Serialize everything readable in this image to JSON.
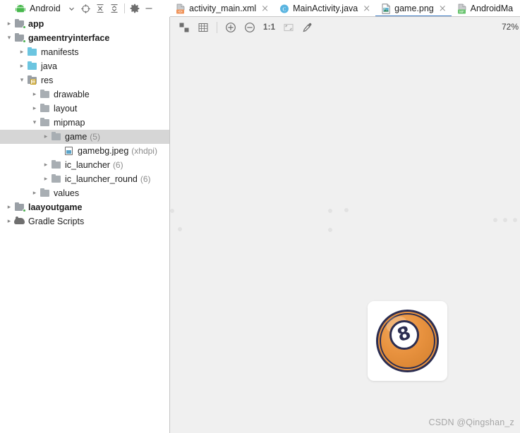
{
  "project_panel": {
    "title": "Android",
    "icons": [
      {
        "name": "android-logo-icon",
        "glyph": "android"
      },
      {
        "name": "chevron-down-icon",
        "glyph": "▾"
      },
      {
        "name": "locate-selection-icon",
        "glyph": "⊕"
      },
      {
        "name": "expand-all-icon",
        "glyph": "⨌"
      },
      {
        "name": "collapse-all-icon",
        "glyph": "⨋"
      },
      {
        "name": "gear-settings-icon",
        "glyph": "⚙"
      },
      {
        "name": "hide-panel-icon",
        "glyph": "—"
      }
    ],
    "tree": [
      {
        "label": "app",
        "suffix": "",
        "depth": 0,
        "arrow": "collapsed",
        "bold": true,
        "icon": "module-folder-icon",
        "selected": false
      },
      {
        "label": "gameentryinterface",
        "suffix": "",
        "depth": 0,
        "arrow": "expanded",
        "bold": true,
        "icon": "module-folder-icon",
        "selected": false
      },
      {
        "label": "manifests",
        "suffix": "",
        "depth": 1,
        "arrow": "collapsed",
        "bold": false,
        "icon": "blue-folder-icon",
        "selected": false
      },
      {
        "label": "java",
        "suffix": "",
        "depth": 1,
        "arrow": "collapsed",
        "bold": false,
        "icon": "blue-folder-icon",
        "selected": false
      },
      {
        "label": "res",
        "suffix": "",
        "depth": 1,
        "arrow": "expanded",
        "bold": false,
        "icon": "res-folder-icon",
        "selected": false
      },
      {
        "label": "drawable",
        "suffix": "",
        "depth": 2,
        "arrow": "collapsed",
        "bold": false,
        "icon": "gray-folder-icon",
        "selected": false
      },
      {
        "label": "layout",
        "suffix": "",
        "depth": 2,
        "arrow": "collapsed",
        "bold": false,
        "icon": "gray-folder-icon",
        "selected": false
      },
      {
        "label": "mipmap",
        "suffix": "",
        "depth": 2,
        "arrow": "expanded",
        "bold": false,
        "icon": "gray-folder-icon",
        "selected": false
      },
      {
        "label": "game",
        "suffix": "(5)",
        "depth": 3,
        "arrow": "collapsed",
        "bold": false,
        "icon": "gray-folder-icon",
        "selected": true
      },
      {
        "label": "gamebg.jpeg",
        "suffix": "(xhdpi)",
        "depth": 4,
        "arrow": "none",
        "bold": false,
        "icon": "image-file-icon",
        "selected": false
      },
      {
        "label": "ic_launcher",
        "suffix": "(6)",
        "depth": 3,
        "arrow": "collapsed",
        "bold": false,
        "icon": "gray-folder-icon",
        "selected": false
      },
      {
        "label": "ic_launcher_round",
        "suffix": "(6)",
        "depth": 3,
        "arrow": "collapsed",
        "bold": false,
        "icon": "gray-folder-icon",
        "selected": false
      },
      {
        "label": "values",
        "suffix": "",
        "depth": 2,
        "arrow": "collapsed",
        "bold": false,
        "icon": "gray-folder-icon",
        "selected": false
      },
      {
        "label": "laayoutgame",
        "suffix": "",
        "depth": 0,
        "arrow": "collapsed",
        "bold": true,
        "icon": "module-folder-icon",
        "selected": false
      },
      {
        "label": "Gradle Scripts",
        "suffix": "",
        "depth": 0,
        "arrow": "collapsed",
        "bold": false,
        "icon": "gradle-icon",
        "selected": false
      }
    ]
  },
  "editor": {
    "tabs": [
      {
        "label": "activity_main.xml",
        "icon": "xml-layout-file-icon",
        "active": false,
        "close": "×"
      },
      {
        "label": "MainActivity.java",
        "icon": "java-class-file-icon",
        "active": false,
        "close": "×"
      },
      {
        "label": "game.png",
        "icon": "png-image-file-icon",
        "active": true,
        "close": "×"
      },
      {
        "label": "AndroidMa",
        "icon": "manifest-file-icon",
        "active": false,
        "close": ""
      }
    ],
    "toolbar": {
      "buttons": [
        {
          "name": "toggle-transparency-chessboard-button",
          "glyph": "checker"
        },
        {
          "name": "toggle-grid-button",
          "glyph": "grid"
        },
        {
          "name": "zoom-in-button",
          "glyph": "plus-circle"
        },
        {
          "name": "zoom-out-button",
          "glyph": "minus-circle"
        },
        {
          "name": "actual-size-button",
          "glyph": "1:1"
        },
        {
          "name": "fit-to-window-button",
          "glyph": "fit"
        },
        {
          "name": "color-picker-button",
          "glyph": "eyedropper"
        }
      ],
      "ratio_label": "1:1",
      "zoom_level": "72%"
    },
    "image": {
      "name": "game.png",
      "alt": "orange 8-ball billiard icon on white rounded square",
      "ball_number": "8",
      "colors": {
        "ball_orange": "#e8923f",
        "ball_outline": "#2b2d51",
        "card_white": "#ffffff",
        "canvas_bg": "#f0f0f0"
      }
    },
    "watermark": "CSDN @Qingshan_z"
  },
  "theme": {
    "accent": "#3f7cc4",
    "selection_bg": "#d6d6d6",
    "panel_border": "#c4c4c4"
  }
}
